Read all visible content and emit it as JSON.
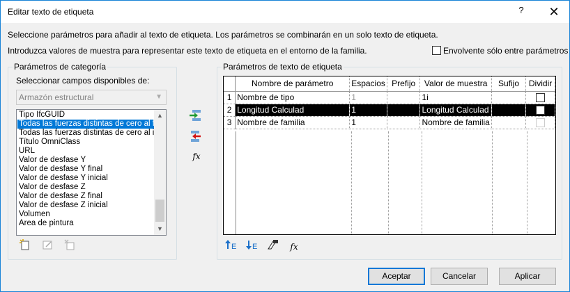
{
  "window": {
    "title": "Editar texto de etiqueta",
    "help_label": "?",
    "close_label": "✕"
  },
  "instructions": {
    "line1": "Seleccione parámetros para añadir al texto de etiqueta. Los parámetros se combinarán en un solo texto de etiqueta.",
    "line2": "Introduzca valores de muestra para representar este texto de etiqueta en el entorno de la familia."
  },
  "wrap_checkbox": {
    "label": "Envolvente sólo entre parámetros",
    "checked": false
  },
  "category_panel": {
    "legend": "Parámetros de categoría",
    "select_label": "Seleccionar campos disponibles de:",
    "combo_value": "Armazón estructural",
    "items": [
      "Tipo IfcGUID",
      "Todas las fuerzas distintas de cero al final",
      "Todas las fuerzas distintas de cero al inicio",
      "Título OmniClass",
      "URL",
      "Valor de desfase Y",
      "Valor de desfase Y final",
      "Valor de desfase Y inicial",
      "Valor de desfase Z",
      "Valor de desfase Z final",
      "Valor de desfase Z inicial",
      "Volumen",
      "Área de pintura"
    ],
    "selected_index": 1
  },
  "middle_buttons": {
    "fx_label": "fx"
  },
  "label_panel": {
    "legend": "Parámetros de texto de etiqueta",
    "columns": [
      "",
      "Nombre de parámetro",
      "Espacios",
      "Prefijo",
      "Valor de muestra",
      "Sufijo",
      "Dividir"
    ],
    "rows": [
      {
        "num": "1",
        "name": "Nombre de tipo",
        "spaces": "1",
        "prefix": "",
        "sample": "1i",
        "suffix": "",
        "split": false
      },
      {
        "num": "2",
        "name": "Longitud Calculad",
        "spaces": "1",
        "prefix": "",
        "sample": "Longitud Calculad",
        "suffix": "",
        "split": false
      },
      {
        "num": "3",
        "name": "Nombre de familia",
        "spaces": "1",
        "prefix": "",
        "sample": "Nombre de familia",
        "suffix": "",
        "split": false
      }
    ],
    "selected_row": 1
  },
  "buttons": {
    "ok": "Aceptar",
    "cancel": "Cancelar",
    "apply": "Aplicar"
  }
}
